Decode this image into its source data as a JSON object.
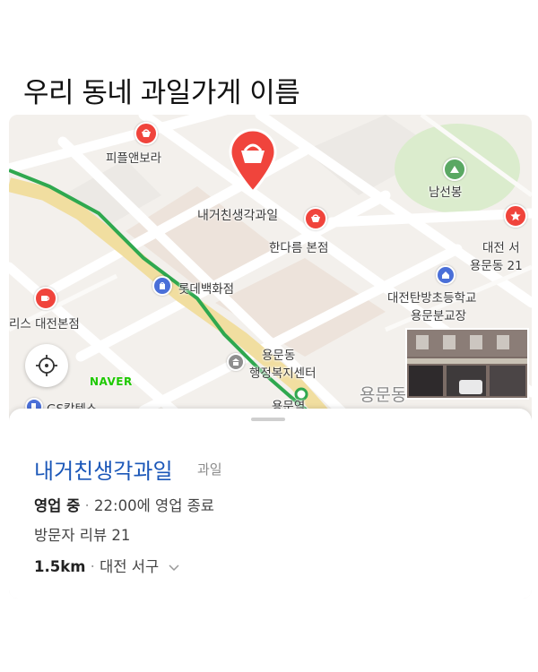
{
  "caption": "우리 동네 과일가게 이름",
  "map": {
    "labels": {
      "piple": "피플앤보라",
      "selected": "내거친생각과일",
      "handarum": "한다름 본점",
      "lotte": "롯데백화점",
      "starbucks_left": "리스 대전본점",
      "yongmun_center_1": "용문동",
      "yongmun_center_2": "행정복지센터",
      "station": "용문역",
      "gs": "GS칼텍스",
      "namseonbong": "남선봉",
      "daejeon_seo_1": "대전 서",
      "daejeon_seo_2": "용문동 21",
      "school_1": "대전탄방초등학교",
      "school_2": "용문분교장",
      "district": "용문동",
      "naver": "NAVER"
    },
    "colors": {
      "pin_red": "#f0443c",
      "subway_green": "#2fa84f",
      "poi_blue": "#4a6fd8",
      "park_green": "#5aa863",
      "road_yellow": "#f1dea0"
    }
  },
  "place": {
    "name": "내거친생각과일",
    "category": "과일",
    "status": "영업 중",
    "hours": "22:00에 영업 종료",
    "reviews": "방문자 리뷰 21",
    "distance": "1.5km",
    "area": "대전 서구"
  }
}
